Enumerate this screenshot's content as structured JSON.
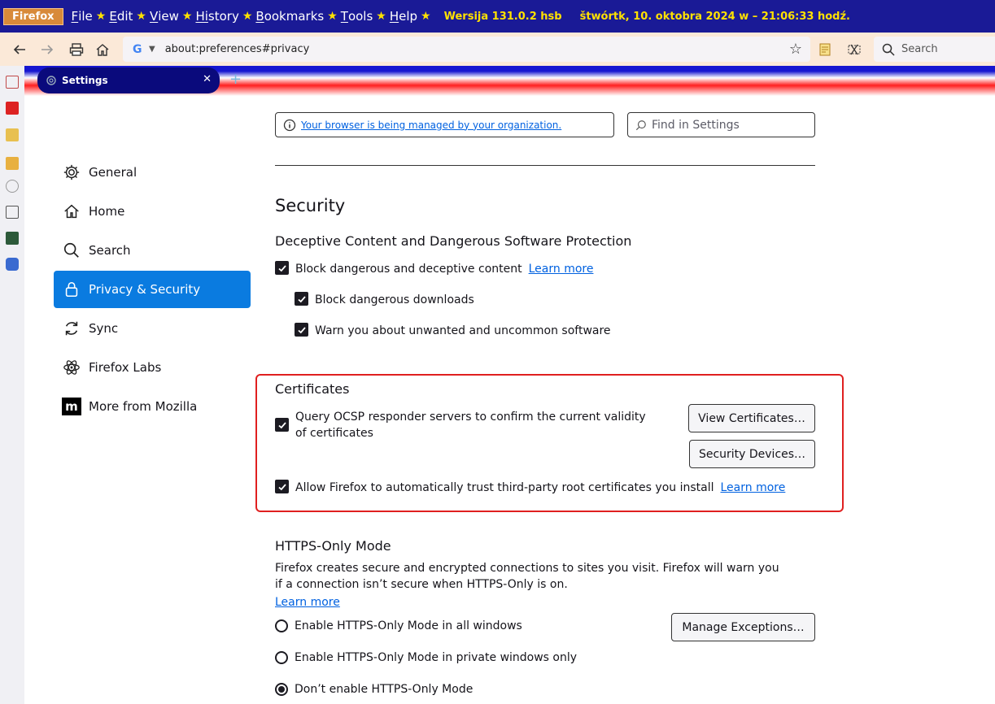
{
  "menubar": {
    "brand": "Firefox",
    "items": [
      {
        "u": "F",
        "rest": "ile"
      },
      {
        "u": "E",
        "rest": "dit"
      },
      {
        "u": "V",
        "rest": "iew"
      },
      {
        "u": "Hi",
        "rest": "story"
      },
      {
        "u": "B",
        "rest": "ookmarks"
      },
      {
        "u": "T",
        "rest": "ools"
      },
      {
        "u": "H",
        "rest": "elp"
      }
    ],
    "star": "★",
    "version": "Wersija 131.0.2 hsb",
    "datetime": "štwórtk, 10. oktobra 2024 w – 21:06:33 hodź."
  },
  "navbar": {
    "url": "about:preferences#privacy",
    "search_engine": "G",
    "search_placeholder": "Search"
  },
  "tab": {
    "title": "Settings",
    "close": "✕",
    "new": "+"
  },
  "settings_nav": {
    "categories": [
      {
        "label": "General",
        "icon": "gear-icon"
      },
      {
        "label": "Home",
        "icon": "home-icon"
      },
      {
        "label": "Search",
        "icon": "search-icon"
      },
      {
        "label": "Privacy & Security",
        "icon": "lock-icon",
        "selected": true
      },
      {
        "label": "Sync",
        "icon": "sync-icon"
      },
      {
        "label": "Firefox Labs",
        "icon": "atom-icon"
      },
      {
        "label": "More from Mozilla",
        "icon": "mozilla-icon"
      }
    ]
  },
  "top": {
    "managed": "Your browser is being managed by your organization.",
    "find_placeholder": "Find in Settings"
  },
  "security": {
    "title": "Security",
    "deceptive_title": "Deceptive Content and Dangerous Software Protection",
    "block_deceptive": "Block dangerous and deceptive content",
    "learn_more": "Learn more",
    "block_downloads": "Block dangerous downloads",
    "warn_unwanted": "Warn you about unwanted and uncommon software"
  },
  "certificates": {
    "title": "Certificates",
    "ocsp": "Query OCSP responder servers to confirm the current validity of certificates",
    "view_btn": "View Certificates…",
    "devices_btn": "Security Devices…",
    "third_party": "Allow Firefox to automatically trust third-party root certificates you install",
    "learn_more": "Learn more"
  },
  "https": {
    "title": "HTTPS-Only Mode",
    "desc": "Firefox creates secure and encrypted connections to sites you visit. Firefox will warn you if a connection isn’t secure when HTTPS-Only is on.",
    "learn_more": "Learn more",
    "manage_btn": "Manage Exceptions…",
    "opt_all": "Enable HTTPS-Only Mode in all windows",
    "opt_private": "Enable HTTPS-Only Mode in private windows only",
    "opt_none": "Don’t enable HTTPS-Only Mode",
    "selected": "opt_none"
  }
}
